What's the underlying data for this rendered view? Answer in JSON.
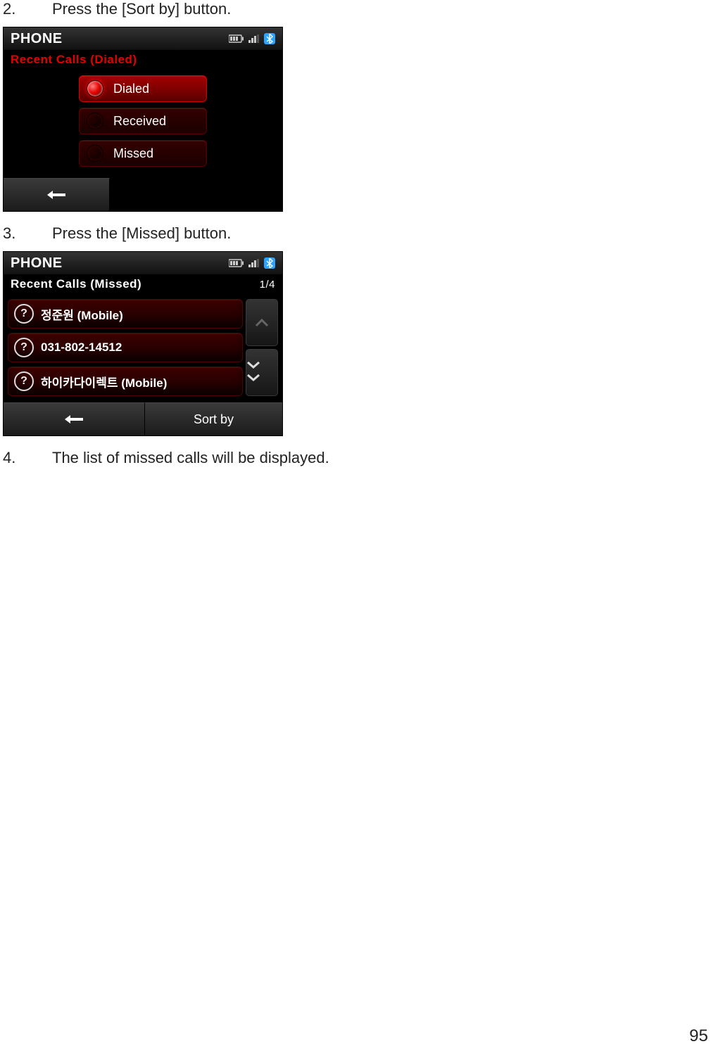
{
  "steps": {
    "s2_num": "2.",
    "s2_text": "Press the [Sort by] button.",
    "s3_num": "3.",
    "s3_text": "Press the [Missed] button.",
    "s4_num": "4.",
    "s4_text": "The list of missed calls will be displayed."
  },
  "screen1": {
    "title": "PHONE",
    "subtitle": "Recent Calls (Dialed)",
    "options": {
      "dialed": "Dialed",
      "received": "Received",
      "missed": "Missed"
    }
  },
  "screen2": {
    "title": "PHONE",
    "subtitle": "Recent Calls (Missed)",
    "pager": "1/4",
    "rows": {
      "r1": "정준원 (Mobile)",
      "r2": "031-802-14512",
      "r3": "하이카다이렉트 (Mobile)"
    },
    "sortby_label": "Sort by"
  },
  "page_number": "95"
}
